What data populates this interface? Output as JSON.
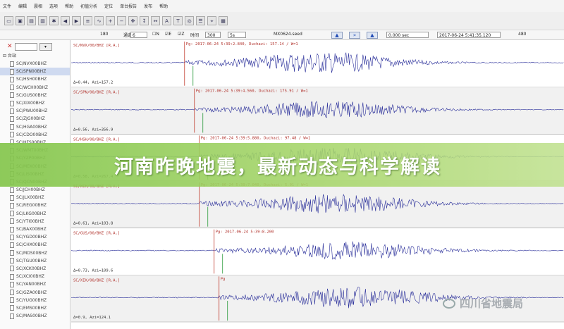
{
  "menu": [
    "文件",
    "编辑",
    "震相",
    "选项",
    "帮助",
    "初值分析",
    "定位",
    "单台报告",
    "发布",
    "帮助"
  ],
  "toolbar_icons": [
    "open-icon",
    "save-icon",
    "print-icon",
    "copy-icon",
    "config-icon",
    "back-icon",
    "forward-icon",
    "channel-icon",
    "filter-icon",
    "zoom-in-icon",
    "zoom-out-icon",
    "pan-icon",
    "pick-icon",
    "measure-icon",
    "amplitude-icon",
    "period-icon",
    "locate-icon",
    "list-icon",
    "map-icon",
    "report-icon"
  ],
  "ctrl": {
    "count": "180",
    "channel_label": "通道",
    "channel_value": "6",
    "checks": [
      "N",
      "E",
      "Z"
    ],
    "time_label": "时间",
    "time_value": "300",
    "time_unit": "5s",
    "file": "MX0624.seed",
    "nav_up": "▲",
    "nav_mid": "»",
    "nav_down": "▲",
    "offset": "0.000 sec",
    "datetime": "2017-06-24 5:41:35.120",
    "right_num": "480"
  },
  "sidebar": {
    "root": "台站",
    "selected_index": 1,
    "channels": [
      "SC/NVX00BHZ",
      "SC/SPN00BHZ",
      "SC/HSH00BHZ",
      "SC/WCH00BHZ",
      "SC/GUS00BHZ",
      "SC/XIX00BHZ",
      "SC/PWU00BHZ",
      "SC/ZJG00BHZ",
      "SC/HGA00BHZ",
      "SC/CDO00BHZ",
      "SC/HFS00BHZ",
      "SC/WMT00BHZ",
      "SC/YZP00BHZ",
      "SC/MEK00BHZ",
      "SC/LIS00BHZ",
      "SC/QCN00BHZ",
      "SC/JCH00BHZ",
      "SC/JLX00BHZ",
      "SC/REG00BHZ",
      "SC/LKG00BHZ",
      "SC/YTI00BHZ",
      "SC/BAX00BHZ",
      "SC/YGD00BHZ",
      "SC/CHX00BHZ",
      "SC/MDS00BHZ",
      "SC/TGU00BHZ",
      "SC/XCK00BHZ",
      "SC/XCI00BHZ",
      "SC/YAN00BHZ",
      "SC/GZA00BHZ",
      "SC/YUG00BHZ",
      "SC/EMS00BHZ",
      "SC/MAS00BHZ"
    ]
  },
  "traces": [
    {
      "station": "SC/NVX/00/BHZ [R.A.]",
      "pick": "Pg: 2017-06-24 5:39:2.840, Duchazi: 157.14 / W=1",
      "info": "Δ=0.44, Azi=157.2",
      "onset": 0.23,
      "amp": 14
    },
    {
      "station": "SC/SPN/00/BHZ [R.A.]",
      "pick": "Pg: 2017-06-24 5:39:4.560, Duchazi: 175.91 / W=1",
      "info": "Δ=0.56, Azi=356.9",
      "onset": 0.25,
      "amp": 11
    },
    {
      "station": "SC/HSH/00/BHZ [R.A.]",
      "pick": "Pg: 2017-06-24 5:39:5.880, Duchazi: 97.48 / W=1",
      "info": "Δ=0.58, Azi=267.4",
      "onset": 0.26,
      "amp": 12
    },
    {
      "station": "SC/WCH/00/BHZ [R.A.]",
      "pick": "Pg: 2017-06-24 5:39:7.040, Duchazi: 5.01 / W=1",
      "info": "Δ=0.61, Azi=103.8",
      "onset": 0.26,
      "amp": 13
    },
    {
      "station": "SC/GUS/00/BHZ [R.A.]",
      "pick": "Pg: 2017-06-24 5:39:8.200",
      "info": "Δ=0.73, Azi=109.6",
      "onset": 0.29,
      "amp": 12
    },
    {
      "station": "SC/XIX/00/BHZ [R.A.]",
      "pick": "Pg",
      "info": "Δ=0.9, Azi=124.1",
      "onset": 0.3,
      "amp": 14
    }
  ],
  "banner_title": "河南昨晚地震，最新动态与科学解读",
  "watermark": "四川省地震局",
  "colors": {
    "trace": "#2a2f9a",
    "pick": "#c0392b",
    "banner": "#8cc84b"
  }
}
